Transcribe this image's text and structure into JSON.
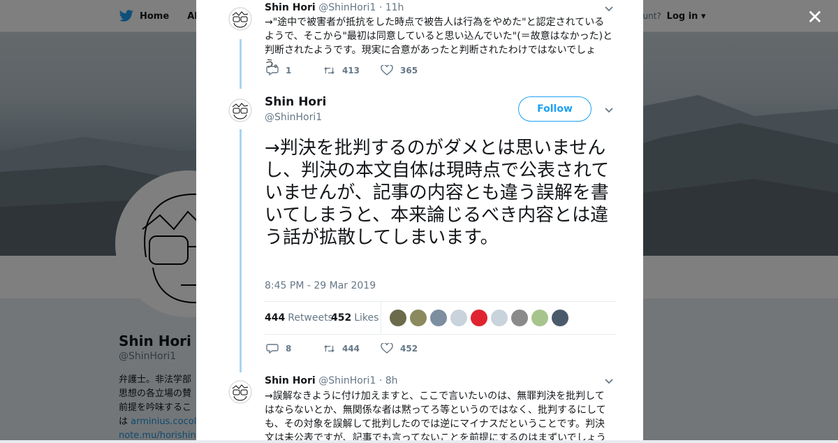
{
  "nav": {
    "home": "Home",
    "about_partial": "Abo",
    "account_prompt_partial": "ccount?",
    "login": "Log in"
  },
  "profile": {
    "name": "Shin Hori",
    "handle": "@ShinHori1",
    "bio_lines": [
      "弁護士。非法学部",
      "思想の各立場の賛",
      "前提を吟味するこ",
      "は "
    ],
    "bio_link1": "arminius.cocolo",
    "bio_link2": "note.mu/horishinb"
  },
  "tweets": [
    {
      "name": "Shin Hori",
      "handle": "@ShinHori1",
      "time": "· 11h",
      "text": "→\"途中で被害者が抵抗をした時点で被告人は行為をやめた\"と認定されているようで、そこから\"最初は同意していると思い込んでいた\"(＝故意はなかった)と判断されたようです。現実に合意があったと判断されたわけではないでしょう。",
      "replies": "1",
      "retweets": "413",
      "likes": "365"
    },
    {
      "name": "Shin Hori",
      "handle": "@ShinHori1",
      "follow_label": "Follow",
      "text": "→判決を批判するのがダメとは思いませんし、判決の本文自体は現時点で公表されていませんが、記事の内容とも違う誤解を書いてしまうと、本来論じるべき内容とは違う話が拡散してしまいます。",
      "timestamp": "8:45 PM - 29 Mar 2019",
      "retweets_count": "444",
      "retweets_label": "Retweets",
      "likes_count": "452",
      "likes_label": "Likes",
      "replies": "8",
      "retweets": "444",
      "likes": "452"
    },
    {
      "name": "Shin Hori",
      "handle": "@ShinHori1",
      "time": "· 8h",
      "text": "→誤解なきように付け加えますと、ここで言いたいのは、無罪判決を批判してはならないとか、無関係な者は黙ってろ等というのではなく、批判するにしても、その対象を誤解して批判したのでは逆にマイナスだということです。判決文は未公表ですが、記事でも言ってないことを前提にするのはまずいでしょう"
    }
  ],
  "likers": [
    {
      "color": "#6b6a4a"
    },
    {
      "color": "#8a8a5e"
    },
    {
      "color": "#7c8ea0"
    },
    {
      "color": "#c9d3dc"
    },
    {
      "color": "#e0242f"
    },
    {
      "color": "#c9d3dc"
    },
    {
      "color": "#8a8a8a"
    },
    {
      "color": "#a7c48d"
    },
    {
      "color": "#4a5a6a"
    }
  ],
  "close_icon": "close-icon"
}
